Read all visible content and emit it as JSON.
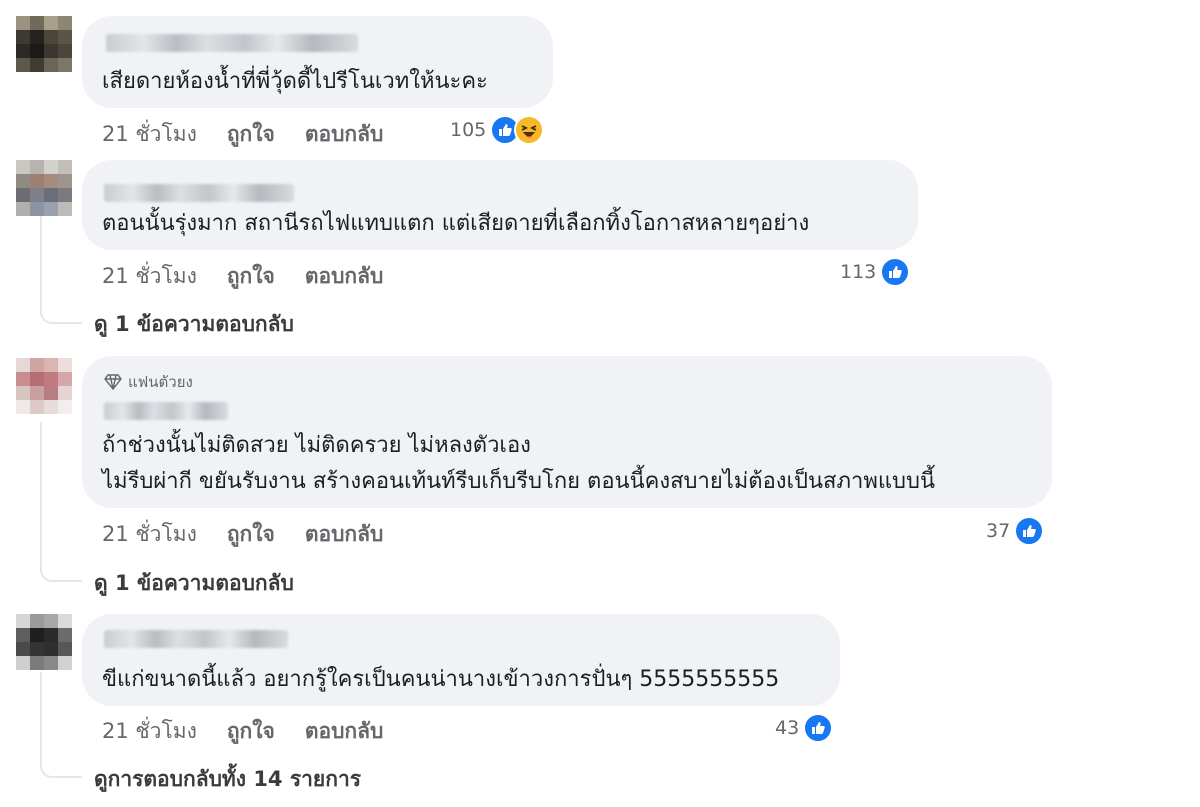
{
  "comments": [
    {
      "text_lines": [
        "เสียดายห้องน้ำที่พี่วุ้ดดี้ไปรีโนเวทให้นะคะ"
      ],
      "time": "21 ชั่วโมง",
      "like_label": "ถูกใจ",
      "reply_label": "ตอบกลับ",
      "reaction_count": "105",
      "reactions": [
        "like-icon",
        "haha-icon"
      ]
    },
    {
      "text_lines": [
        "ตอนนั้นรุ่งมาก สถานีรถไฟแทบแตก แต่เสียดายที่เลือกทิ้งโอกาสหลายๆอย่าง"
      ],
      "time": "21 ชั่วโมง",
      "like_label": "ถูกใจ",
      "reply_label": "ตอบกลับ",
      "reaction_count": "113",
      "reactions": [
        "like-icon"
      ],
      "view_replies": "ดู 1 ข้อความตอบกลับ"
    },
    {
      "badge": "แฟนตัวยง",
      "text_lines": [
        "ถ้าช่วงนั้นไม่ติดสวย ไม่ติดครวย ไม่หลงตัวเอง",
        "ไม่รีบผ่ากี ขยันรับงาน สร้างคอนเท้นท์รีบเก็บรีบโกย ตอนนี้คงสบายไม่ต้องเป็นสภาพแบบนี้"
      ],
      "time": "21 ชั่วโมง",
      "like_label": "ถูกใจ",
      "reply_label": "ตอบกลับ",
      "reaction_count": "37",
      "reactions": [
        "like-icon"
      ],
      "view_replies": "ดู 1 ข้อความตอบกลับ"
    },
    {
      "text_lines": [
        "ขีแก่ขนาดนี้แล้ว อยากรู้ใครเป็นคนน่านางเข้าวงการปั่นๆ 5555555555"
      ],
      "time": "21 ชั่วโมง",
      "like_label": "ถูกใจ",
      "reply_label": "ตอบกลับ",
      "reaction_count": "43",
      "reactions": [
        "like-icon"
      ],
      "view_replies": "ดูการตอบกลับทั้ง 14 รายการ"
    }
  ],
  "colors": {
    "bubble": "#f0f2f5",
    "meta_text": "#65676b",
    "like_blue": "#1877f2",
    "haha_yellow": "#f7b928"
  }
}
